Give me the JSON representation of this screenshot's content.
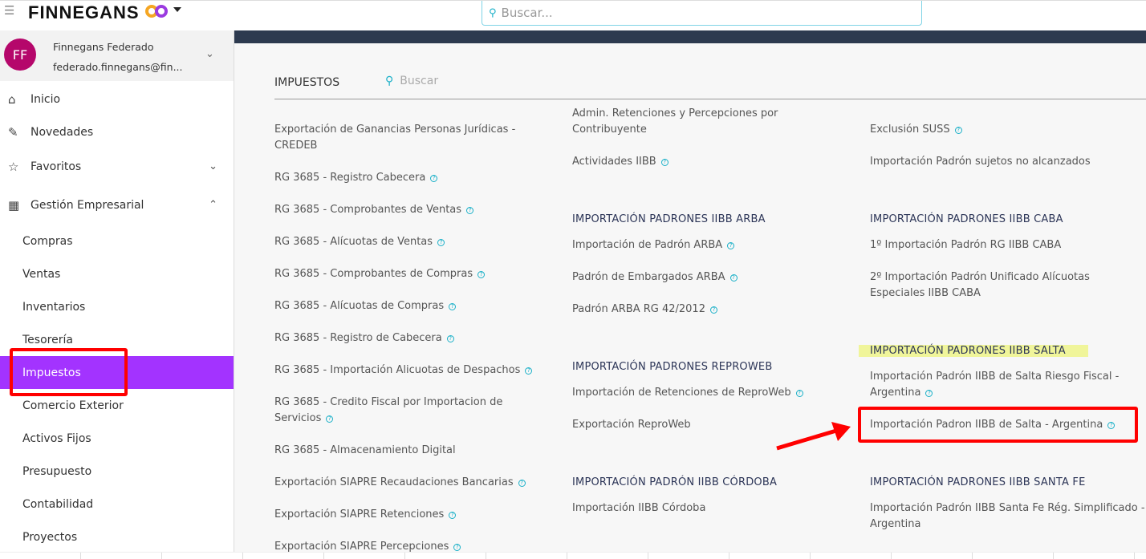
{
  "topbar": {
    "brand": "FINNEGANS",
    "search_placeholder": "Buscar..."
  },
  "user": {
    "initials": "FF",
    "name": "Finnegans Federado",
    "email": "federado.finnegans@fin..."
  },
  "sidebar": {
    "items": [
      {
        "label": "Inicio",
        "icon": "home-icon"
      },
      {
        "label": "Novedades",
        "icon": "pin-icon"
      },
      {
        "label": "Favoritos",
        "icon": "star-icon"
      },
      {
        "label": "Gestión Empresarial",
        "icon": "building-icon"
      }
    ],
    "sub": [
      "Compras",
      "Ventas",
      "Inventarios",
      "Tesorería",
      "Impuestos",
      "Comercio Exterior",
      "Activos Fijos",
      "Presupuesto",
      "Contabilidad",
      "Proyectos"
    ],
    "active": "Impuestos"
  },
  "main": {
    "title": "IMPUESTOS",
    "search_placeholder": "Buscar",
    "col1": [
      "Exportación de Ganancias Personas Jurídicas - CREDEB",
      "RG 3685 - Registro Cabecera",
      "RG 3685 - Comprobantes de Ventas",
      "RG 3685 - Alícuotas de Ventas",
      "RG 3685 - Comprobantes de Compras",
      "RG 3685 - Alícuotas de Compras",
      "RG 3685 - Registro de Cabecera",
      "RG 3685 - Importación Alicuotas de Despachos",
      "RG 3685 - Credito Fiscal por Importacion de Servicios",
      "RG 3685 - Almacenamiento Digital",
      "Exportación SIAPRE Recaudaciones Bancarias",
      "Exportación SIAPRE Retenciones",
      "Exportación SIAPRE Percepciones"
    ],
    "col2": {
      "top": [
        "Admin. Retenciones y Percepciones por Contribuyente",
        "Actividades IIBB"
      ],
      "arba": {
        "heading": "IMPORTACIÓN PADRONES IIBB ARBA",
        "items": [
          "Importación de Padrón ARBA",
          "Padrón de Embargados ARBA",
          "Padrón ARBA RG 42/2012"
        ]
      },
      "reproweb": {
        "heading": "IMPORTACIÓN PADRONES REPROWEB",
        "items": [
          "Importación de Retenciones de ReproWeb",
          "Exportación ReproWeb"
        ]
      },
      "cordoba": {
        "heading": "IMPORTACIÓN PADRÓN IIBB CÓRDOBA",
        "items": [
          "Importación IIBB Córdoba"
        ]
      }
    },
    "col3": {
      "top": [
        "Exclusión SUSS",
        "Importación Padrón sujetos no alcanzados"
      ],
      "caba": {
        "heading": "IMPORTACIÓN PADRONES IIBB CABA",
        "items": [
          "1º Importación Padrón RG IIBB CABA",
          "2º Importación Padrón Unificado Alícuotas Especiales IIBB CABA"
        ]
      },
      "salta": {
        "heading": "IMPORTACIÓN PADRONES IIBB SALTA",
        "items": [
          "Importación Padrón IIBB de Salta Riesgo Fiscal - Argentina",
          "Importación Padron IIBB de Salta - Argentina"
        ]
      },
      "santafe": {
        "heading": "IMPORTACIÓN PADRONES IIBB SANTA FE",
        "items": [
          "Importación Padrón IIBB Santa Fe Rég. Simplificado - Argentina"
        ]
      }
    }
  },
  "colors": {
    "accent": "#a333ff",
    "help": "#1ab0c8",
    "highlight": "#f0f59a",
    "annotation": "#ff0000",
    "header_band": "#2d3a4f"
  }
}
